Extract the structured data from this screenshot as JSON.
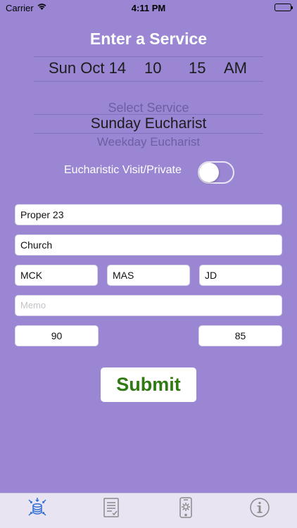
{
  "status_bar": {
    "carrier": "Carrier",
    "time": "4:11 PM"
  },
  "title": "Enter a Service",
  "date_picker": {
    "date": "Sun Oct 14",
    "hour": "10",
    "minute": "15",
    "ampm": "AM"
  },
  "service_picker": {
    "above": "Select Service",
    "selected": "Sunday Eucharist",
    "below": "Weekday Eucharist"
  },
  "toggle": {
    "label": "Eucharistic Visit/Private",
    "on": false
  },
  "fields": {
    "proper": "Proper 23",
    "location": "Church",
    "celebrant": "MCK",
    "preacher": "MAS",
    "officiant": "JD",
    "memo_placeholder": "Memo",
    "count_left": "90",
    "count_right": "85"
  },
  "submit_label": "Submit",
  "colors": {
    "background": "#9a86d2",
    "submit_text": "#2f7a12",
    "tab_active": "#2f6fd6",
    "tab_inactive": "#8a8a8a"
  },
  "tabs": [
    {
      "icon": "database-icon",
      "active": true
    },
    {
      "icon": "document-icon",
      "active": false
    },
    {
      "icon": "phone-settings-icon",
      "active": false
    },
    {
      "icon": "info-icon",
      "active": false
    }
  ]
}
